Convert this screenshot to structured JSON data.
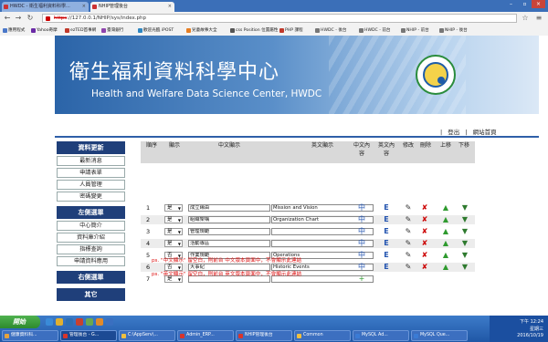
{
  "tabs": [
    {
      "label": "HWDC - 衛生福利資料科學..."
    },
    {
      "label": "NHIP管理後台"
    }
  ],
  "addressbar": {
    "protocol": "https",
    "rest": "://127.0.0.1/NHIP/sys/index.php"
  },
  "bookmarks": [
    {
      "label": "應用程式",
      "color": "#4a78c9"
    },
    {
      "label": "Yahoo奇摩",
      "color": "#6b2aa6"
    },
    {
      "label": "ezTED首事網",
      "color": "#c0392b"
    },
    {
      "label": "臺灣銀行",
      "color": "#8e44ad"
    },
    {
      "label": "歡迎光臨 iPOST",
      "color": "#2e86c1"
    },
    {
      "label": "兒童故事大全",
      "color": "#e67e22"
    },
    {
      "label": "css Position 位置屬性",
      "color": "#555555"
    },
    {
      "label": "PHP 課程",
      "color": "#c0392b"
    },
    {
      "label": "HWDC - 後台",
      "color": "#777777"
    },
    {
      "label": "HWDC - 前台",
      "color": "#777777"
    },
    {
      "label": "NHIP - 前台",
      "color": "#777777"
    },
    {
      "label": "NHIP - 後台",
      "color": "#777777"
    }
  ],
  "banner": {
    "title_cn": "衛生福利資料科學中心",
    "title_en": "Health and Welfare Data Science Center, HWDC"
  },
  "toplinks": {
    "logout": "登出",
    "home": "網站首頁",
    "sep": "|"
  },
  "sidebar": {
    "sections": [
      {
        "heading": "資料更新",
        "items": [
          "最新消息",
          "申請表單",
          "人員管理",
          "密碼變更"
        ]
      },
      {
        "heading": "左側選單",
        "items": [
          "中心簡介",
          "資料庫介紹",
          "指標查詢",
          "申請資料應用"
        ]
      },
      {
        "heading": "右側選單",
        "items": []
      },
      {
        "heading": "其它",
        "items": []
      }
    ]
  },
  "table": {
    "headers": {
      "order": "順序",
      "display": "顯示",
      "cn_display": "中文顯示",
      "en_display": "英文顯示",
      "cn_content": "中文內容",
      "en_content": "英文內容",
      "edit": "修改",
      "delete": "刪除",
      "up": "上移",
      "down": "下移"
    },
    "rows": [
      {
        "num": "1",
        "display": "是",
        "cn": "成立緣由",
        "en": "Mission and Vision"
      },
      {
        "num": "2",
        "display": "是",
        "cn": "組織架構",
        "en": "Organization Chart"
      },
      {
        "num": "3",
        "display": "是",
        "cn": "管理規範",
        "en": ""
      },
      {
        "num": "4",
        "display": "是",
        "cn": "活動專區",
        "en": ""
      },
      {
        "num": "5",
        "display": "否",
        "cn": "作業規範",
        "en": "Operations"
      },
      {
        "num": "6",
        "display": "否",
        "cn": "大事紀",
        "en": "Historic Events"
      },
      {
        "num": "7",
        "display": "是",
        "cn": "",
        "en": ""
      }
    ],
    "icons": {
      "tree": "中",
      "e": "E",
      "edit": "✎",
      "del": "✘",
      "up": "▲",
      "down": "▼",
      "add": "+"
    }
  },
  "notes": [
    "ps. \"中文顯示\" 留空白，則前台 中文版本頁面中，不會顯示此連結",
    "ps. \"英文顯示\" 留空白，則前台 英文版本頁面中，不會顯示此連結"
  ],
  "taskbar": {
    "start": "開始",
    "items": [
      {
        "label": "健康資料科...",
        "color": "#e6a23c"
      },
      {
        "label": "管理後台 - G...",
        "color": "#d9342b"
      },
      {
        "label": "C:\\AppServ\\...",
        "color": "#f0c040"
      },
      {
        "label": "Admin_ERP...",
        "color": "#d9342b"
      },
      {
        "label": "NHIP管理後台",
        "color": "#d9342b"
      },
      {
        "label": "Common",
        "color": "#f0c040"
      },
      {
        "label": "MySQL Ad...",
        "color": "#3a7bd5"
      },
      {
        "label": "MySQL Que...",
        "color": "#3a7bd5"
      }
    ],
    "time": "下午 12:24",
    "day": "星期三",
    "date": "2016/10/19"
  }
}
